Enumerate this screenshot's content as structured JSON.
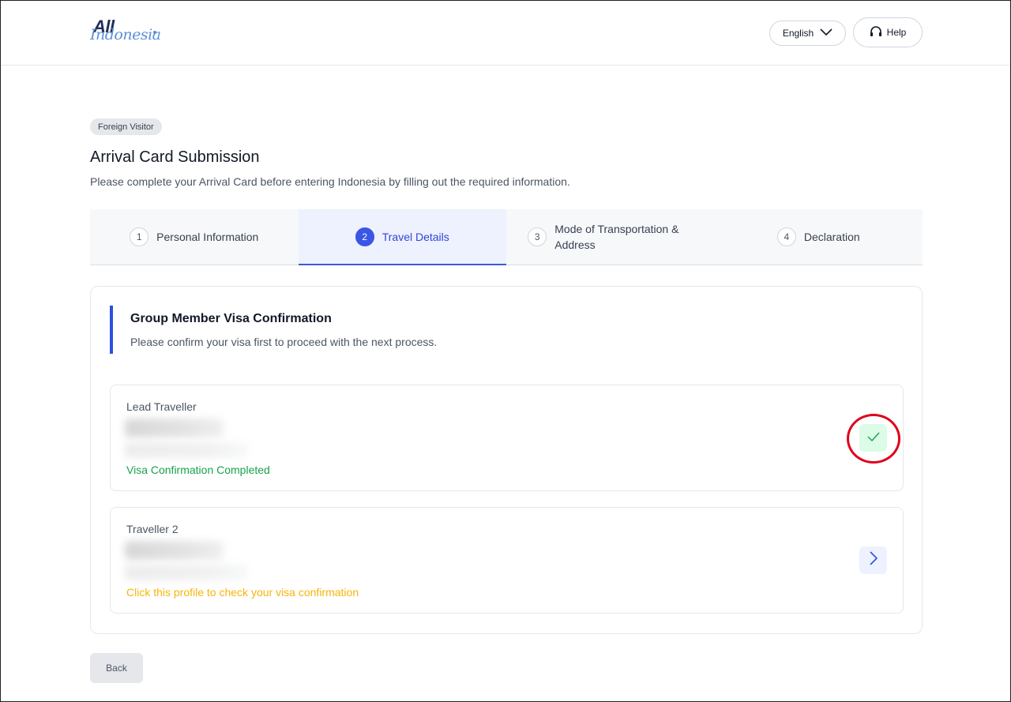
{
  "header": {
    "logo": {
      "text_top": "All",
      "text_bottom": "Indonesia"
    },
    "language_label": "English",
    "help_label": "Help"
  },
  "badge": "Foreign Visitor",
  "page": {
    "title": "Arrival Card Submission",
    "subtitle": "Please complete your Arrival Card before entering Indonesia by filling out the required information."
  },
  "steps": [
    {
      "number": "1",
      "label": "Personal Information",
      "active": false
    },
    {
      "number": "2",
      "label": "Travel Details",
      "active": true
    },
    {
      "number": "3",
      "label": "Mode of Transportation & Address",
      "active": false
    },
    {
      "number": "4",
      "label": "Declaration",
      "active": false
    }
  ],
  "section": {
    "title": "Group Member Visa Confirmation",
    "subtitle": "Please confirm your visa first to proceed with the next process."
  },
  "travellers": [
    {
      "label": "Lead Traveller",
      "status": "Visa Confirmation Completed",
      "state": "completed",
      "icon": "check-icon"
    },
    {
      "label": "Traveller 2",
      "status": "Click this profile to check your visa confirmation",
      "state": "pending",
      "icon": "chevron-right-icon"
    }
  ],
  "actions": {
    "back_label": "Back"
  },
  "colors": {
    "accent": "#3b55e6",
    "success": "#16a34a",
    "warning": "#f5b50a",
    "annotation": "#e0001a"
  }
}
